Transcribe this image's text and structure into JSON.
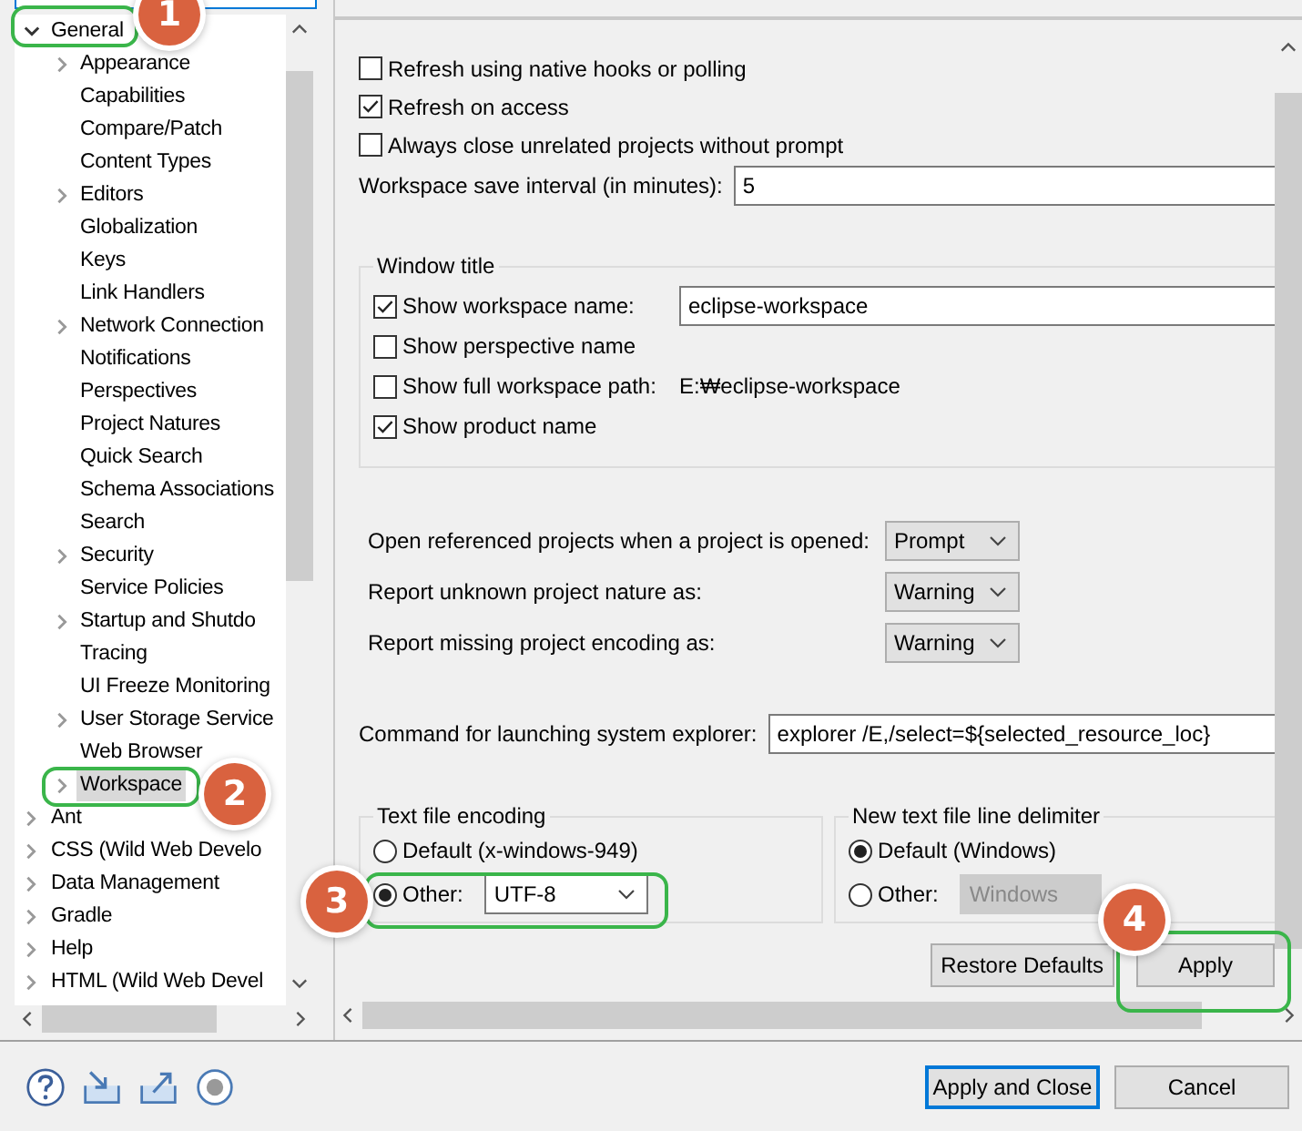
{
  "tree": [
    {
      "label": "General",
      "expandable": true,
      "expanded": true,
      "selected": false,
      "children": [
        {
          "label": "Appearance",
          "expandable": true,
          "expanded": false,
          "selected": false
        },
        {
          "label": "Capabilities",
          "expandable": false,
          "selected": false
        },
        {
          "label": "Compare/Patch",
          "expandable": false,
          "selected": false
        },
        {
          "label": "Content Types",
          "expandable": false,
          "selected": false
        },
        {
          "label": "Editors",
          "expandable": true,
          "expanded": false,
          "selected": false
        },
        {
          "label": "Globalization",
          "expandable": false,
          "selected": false
        },
        {
          "label": "Keys",
          "expandable": false,
          "selected": false
        },
        {
          "label": "Link Handlers",
          "expandable": false,
          "selected": false
        },
        {
          "label": "Network Connection",
          "expandable": true,
          "expanded": false,
          "selected": false
        },
        {
          "label": "Notifications",
          "expandable": false,
          "selected": false
        },
        {
          "label": "Perspectives",
          "expandable": false,
          "selected": false
        },
        {
          "label": "Project Natures",
          "expandable": false,
          "selected": false
        },
        {
          "label": "Quick Search",
          "expandable": false,
          "selected": false
        },
        {
          "label": "Schema Associations",
          "expandable": false,
          "selected": false
        },
        {
          "label": "Search",
          "expandable": false,
          "selected": false
        },
        {
          "label": "Security",
          "expandable": true,
          "expanded": false,
          "selected": false
        },
        {
          "label": "Service Policies",
          "expandable": false,
          "selected": false
        },
        {
          "label": "Startup and Shutdo",
          "expandable": true,
          "expanded": false,
          "selected": false
        },
        {
          "label": "Tracing",
          "expandable": false,
          "selected": false
        },
        {
          "label": "UI Freeze Monitoring",
          "expandable": false,
          "selected": false
        },
        {
          "label": "User Storage Service",
          "expandable": true,
          "expanded": false,
          "selected": false
        },
        {
          "label": "Web Browser",
          "expandable": false,
          "selected": false
        },
        {
          "label": "Workspace",
          "expandable": true,
          "expanded": false,
          "selected": true
        }
      ]
    },
    {
      "label": "Ant",
      "expandable": true,
      "expanded": false,
      "selected": false
    },
    {
      "label": "CSS (Wild Web Develo",
      "expandable": true,
      "expanded": false,
      "selected": false
    },
    {
      "label": "Data Management",
      "expandable": true,
      "expanded": false,
      "selected": false
    },
    {
      "label": "Gradle",
      "expandable": true,
      "expanded": false,
      "selected": false
    },
    {
      "label": "Help",
      "expandable": true,
      "expanded": false,
      "selected": false
    },
    {
      "label": "HTML (Wild Web Devel",
      "expandable": true,
      "expanded": false,
      "selected": false
    }
  ],
  "checkboxes": [
    {
      "label": "Refresh using native hooks or polling",
      "checked": false
    },
    {
      "label": "Refresh on access",
      "checked": true
    },
    {
      "label": "Always close unrelated projects without prompt",
      "checked": false
    }
  ],
  "save_interval": {
    "label": "Workspace save interval (in minutes):",
    "value": "5"
  },
  "window_title": {
    "title": "Window title",
    "rows": [
      {
        "kind": "field",
        "label": "Show workspace name:",
        "checked": true,
        "value": "eclipse-workspace"
      },
      {
        "kind": "plain",
        "label": "Show perspective name",
        "checked": false
      },
      {
        "kind": "path",
        "label": "Show full workspace path:",
        "checked": false,
        "value": "E:₩eclipse-workspace"
      },
      {
        "kind": "plain",
        "label": "Show product name",
        "checked": true
      }
    ]
  },
  "dropdowns": [
    {
      "label": "Open referenced projects when a project is opened:",
      "value": "Prompt"
    },
    {
      "label": "Report unknown project nature as:",
      "value": "Warning"
    },
    {
      "label": "Report missing project encoding as:",
      "value": "Warning"
    }
  ],
  "explorer_command": {
    "label": "Command for launching system explorer:",
    "value": "explorer /E,/select=${selected_resource_loc}"
  },
  "encoding": {
    "title": "Text file encoding",
    "options": [
      {
        "label": "Default (x-windows-949)",
        "selected": false
      },
      {
        "label": "Other:",
        "selected": true,
        "value": "UTF-8",
        "disabled": false
      }
    ]
  },
  "line_delimiter": {
    "title": "New text file line delimiter",
    "options": [
      {
        "label": "Default (Windows)",
        "selected": true
      },
      {
        "label": "Other:",
        "selected": false,
        "value": "Windows",
        "disabled": true
      }
    ]
  },
  "page_buttons": [
    "Restore Defaults",
    "Apply"
  ],
  "footer_buttons": [
    {
      "label": "Apply and Close",
      "default": true
    },
    {
      "label": "Cancel",
      "default": false
    }
  ],
  "callouts": [
    {
      "number": "1"
    },
    {
      "number": "2"
    },
    {
      "number": "3"
    },
    {
      "number": "4"
    }
  ]
}
